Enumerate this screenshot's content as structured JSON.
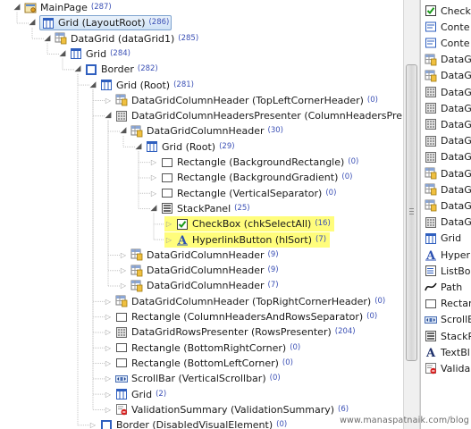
{
  "tree": [
    {
      "name": "MainPage",
      "count": "(287)",
      "icon": "page-icon",
      "depth": 0,
      "toggle": "expanded"
    },
    {
      "name": "Grid (LayoutRoot)",
      "count": "(286)",
      "icon": "grid-icon",
      "depth": 1,
      "toggle": "expanded",
      "selected": true
    },
    {
      "name": "DataGrid (dataGrid1)",
      "count": "(285)",
      "icon": "datagrid-icon",
      "depth": 2,
      "toggle": "expanded"
    },
    {
      "name": "Grid",
      "count": "(284)",
      "icon": "grid-icon",
      "depth": 3,
      "toggle": "expanded"
    },
    {
      "name": "Border",
      "count": "(282)",
      "icon": "border-icon",
      "depth": 4,
      "toggle": "expanded"
    },
    {
      "name": "Grid (Root)",
      "count": "(281)",
      "icon": "grid-icon",
      "depth": 5,
      "toggle": "expanded"
    },
    {
      "name": "DataGridColumnHeader (TopLeftCornerHeader)",
      "count": "(0)",
      "icon": "datagrid-icon",
      "depth": 6,
      "toggle": "collapsed"
    },
    {
      "name": "DataGridColumnHeadersPresenter (ColumnHeadersPresenter)",
      "count": "",
      "icon": "presenter-icon",
      "depth": 6,
      "toggle": "expanded"
    },
    {
      "name": "DataGridColumnHeader",
      "count": "(30)",
      "icon": "datagrid-icon",
      "depth": 7,
      "toggle": "expanded"
    },
    {
      "name": "Grid (Root)",
      "count": "(29)",
      "icon": "grid-icon",
      "depth": 8,
      "toggle": "expanded"
    },
    {
      "name": "Rectangle (BackgroundRectangle)",
      "count": "(0)",
      "icon": "rectangle-icon",
      "depth": 9,
      "toggle": "collapsed"
    },
    {
      "name": "Rectangle (BackgroundGradient)",
      "count": "(0)",
      "icon": "rectangle-icon",
      "depth": 9,
      "toggle": "collapsed"
    },
    {
      "name": "Rectangle (VerticalSeparator)",
      "count": "(0)",
      "icon": "rectangle-icon",
      "depth": 9,
      "toggle": "collapsed"
    },
    {
      "name": "StackPanel",
      "count": "(25)",
      "icon": "stackpanel-icon",
      "depth": 9,
      "toggle": "expanded"
    },
    {
      "name": "CheckBox (chkSelectAll)",
      "count": "(16)",
      "icon": "checkbox-icon",
      "depth": 10,
      "toggle": "collapsed",
      "highlight": true
    },
    {
      "name": "HyperlinkButton (hlSort)",
      "count": "(7)",
      "icon": "hyperlink-icon",
      "depth": 10,
      "toggle": "collapsed",
      "highlight": true
    },
    {
      "name": "DataGridColumnHeader",
      "count": "(9)",
      "icon": "datagrid-icon",
      "depth": 7,
      "toggle": "collapsed"
    },
    {
      "name": "DataGridColumnHeader",
      "count": "(9)",
      "icon": "datagrid-icon",
      "depth": 7,
      "toggle": "collapsed"
    },
    {
      "name": "DataGridColumnHeader",
      "count": "(7)",
      "icon": "datagrid-icon",
      "depth": 7,
      "toggle": "collapsed"
    },
    {
      "name": "DataGridColumnHeader (TopRightCornerHeader)",
      "count": "(0)",
      "icon": "datagrid-icon",
      "depth": 6,
      "toggle": "collapsed"
    },
    {
      "name": "Rectangle (ColumnHeadersAndRowsSeparator)",
      "count": "(0)",
      "icon": "rectangle-icon",
      "depth": 6,
      "toggle": "collapsed"
    },
    {
      "name": "DataGridRowsPresenter (RowsPresenter)",
      "count": "(204)",
      "icon": "presenter-icon",
      "depth": 6,
      "toggle": "collapsed"
    },
    {
      "name": "Rectangle (BottomRightCorner)",
      "count": "(0)",
      "icon": "rectangle-icon",
      "depth": 6,
      "toggle": "collapsed"
    },
    {
      "name": "Rectangle (BottomLeftCorner)",
      "count": "(0)",
      "icon": "rectangle-icon",
      "depth": 6,
      "toggle": "collapsed"
    },
    {
      "name": "ScrollBar (VerticalScrollbar)",
      "count": "(0)",
      "icon": "scrollbar-icon",
      "depth": 6,
      "toggle": "collapsed"
    },
    {
      "name": "Grid",
      "count": "(2)",
      "icon": "grid-icon",
      "depth": 6,
      "toggle": "collapsed"
    },
    {
      "name": "ValidationSummary (ValidationSummary)",
      "count": "(6)",
      "icon": "validation-icon",
      "depth": 6,
      "toggle": "collapsed"
    },
    {
      "name": "Border (DisabledVisualElement)",
      "count": "(0)",
      "icon": "border-icon",
      "depth": 5,
      "toggle": "collapsed"
    }
  ],
  "side_panel": [
    {
      "label": "CheckB",
      "icon": "checkbox-icon"
    },
    {
      "label": "Conte",
      "icon": "content-icon"
    },
    {
      "label": "Conte",
      "icon": "content-icon"
    },
    {
      "label": "DataG",
      "icon": "datagrid-icon"
    },
    {
      "label": "DataG",
      "icon": "datagrid-icon"
    },
    {
      "label": "DataG",
      "icon": "presenter-icon"
    },
    {
      "label": "DataG",
      "icon": "presenter-icon"
    },
    {
      "label": "DataG",
      "icon": "presenter-icon"
    },
    {
      "label": "DataG",
      "icon": "presenter-icon"
    },
    {
      "label": "DataG",
      "icon": "presenter-icon"
    },
    {
      "label": "DataG",
      "icon": "datagrid-icon"
    },
    {
      "label": "DataG",
      "icon": "datagrid-icon"
    },
    {
      "label": "DataG",
      "icon": "datagrid-icon"
    },
    {
      "label": "DataG",
      "icon": "presenter-icon"
    },
    {
      "label": "Grid",
      "icon": "grid-icon"
    },
    {
      "label": "Hyper",
      "icon": "hyperlink-icon"
    },
    {
      "label": "ListBo",
      "icon": "listbox-icon"
    },
    {
      "label": "Path",
      "icon": "path-icon"
    },
    {
      "label": "Rectar",
      "icon": "rectangle-icon"
    },
    {
      "label": "ScrollB",
      "icon": "scrollbar-icon"
    },
    {
      "label": "StackP",
      "icon": "stackpanel-icon"
    },
    {
      "label": "TextBl",
      "icon": "textblock-icon"
    },
    {
      "label": "Valida",
      "icon": "validation-icon"
    }
  ],
  "watermark": "www.manaspatnaik.com/blog",
  "colors": {
    "highlight": "#fffd7c",
    "count": "#3a4fb5",
    "selection": "#cfe2f6"
  }
}
